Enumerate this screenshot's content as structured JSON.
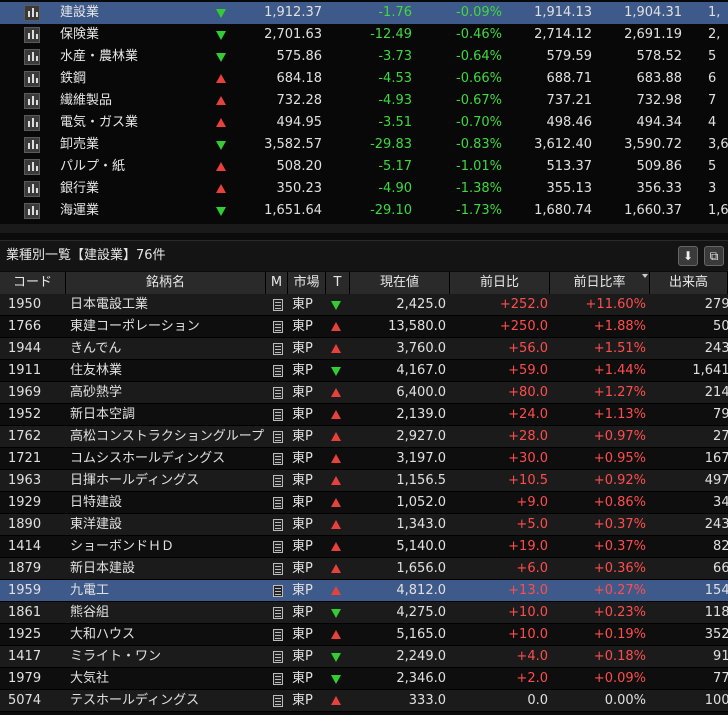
{
  "sectors": [
    {
      "name": "建設業",
      "dir": "down",
      "price": "1,912.37",
      "chg": "-1.76",
      "pct": "-0.09%",
      "open": "1,914.13",
      "low": "1,904.31",
      "extra": "1,",
      "selected": true
    },
    {
      "name": "保険業",
      "dir": "down",
      "price": "2,701.63",
      "chg": "-12.49",
      "pct": "-0.46%",
      "open": "2,714.12",
      "low": "2,691.19",
      "extra": "2,"
    },
    {
      "name": "水産・農林業",
      "dir": "down",
      "price": "575.86",
      "chg": "-3.73",
      "pct": "-0.64%",
      "open": "579.59",
      "low": "578.52",
      "extra": "5"
    },
    {
      "name": "鉄鋼",
      "dir": "up",
      "price": "684.18",
      "chg": "-4.53",
      "pct": "-0.66%",
      "open": "688.71",
      "low": "683.88",
      "extra": "6"
    },
    {
      "name": "繊維製品",
      "dir": "up",
      "price": "732.28",
      "chg": "-4.93",
      "pct": "-0.67%",
      "open": "737.21",
      "low": "732.98",
      "extra": "7"
    },
    {
      "name": "電気・ガス業",
      "dir": "up",
      "price": "494.95",
      "chg": "-3.51",
      "pct": "-0.70%",
      "open": "498.46",
      "low": "494.34",
      "extra": "4"
    },
    {
      "name": "卸売業",
      "dir": "down",
      "price": "3,582.57",
      "chg": "-29.83",
      "pct": "-0.83%",
      "open": "3,612.40",
      "low": "3,590.72",
      "extra": "3,6"
    },
    {
      "name": "パルプ・紙",
      "dir": "up",
      "price": "508.20",
      "chg": "-5.17",
      "pct": "-1.01%",
      "open": "513.37",
      "low": "509.86",
      "extra": "5"
    },
    {
      "name": "銀行業",
      "dir": "up",
      "price": "350.23",
      "chg": "-4.90",
      "pct": "-1.38%",
      "open": "355.13",
      "low": "356.33",
      "extra": "3"
    },
    {
      "name": "海運業",
      "dir": "down",
      "price": "1,651.64",
      "chg": "-29.10",
      "pct": "-1.73%",
      "open": "1,680.74",
      "low": "1,660.37",
      "extra": "1,6"
    }
  ],
  "list": {
    "title": "業種別一覧【建設業】76件",
    "download_icon": "⬇",
    "copy_icon": "⧉",
    "headers": {
      "code": "コード",
      "name": "銘柄名",
      "memo": "M",
      "market": "市場",
      "trend": "T",
      "price": "現在値",
      "chg": "前日比",
      "pct": "前日比率",
      "volume": "出来高"
    },
    "rows": [
      {
        "code": "1950",
        "name": "日本電設工業",
        "market": "東P",
        "dir": "down",
        "price": "2,425.0",
        "chg": "+252.0",
        "pct": "+11.60%",
        "vol": "279,6"
      },
      {
        "code": "1766",
        "name": "東建コーポレーション",
        "market": "東P",
        "dir": "up",
        "price": "13,580.0",
        "chg": "+250.0",
        "pct": "+1.88%",
        "vol": "50,8"
      },
      {
        "code": "1944",
        "name": "きんでん",
        "market": "東P",
        "dir": "up",
        "price": "3,760.0",
        "chg": "+56.0",
        "pct": "+1.51%",
        "vol": "243,8"
      },
      {
        "code": "1911",
        "name": "住友林業",
        "market": "東P",
        "dir": "down",
        "price": "4,167.0",
        "chg": "+59.0",
        "pct": "+1.44%",
        "vol": "1,641,4"
      },
      {
        "code": "1969",
        "name": "高砂熱学",
        "market": "東P",
        "dir": "up",
        "price": "6,400.0",
        "chg": "+80.0",
        "pct": "+1.27%",
        "vol": "214,1"
      },
      {
        "code": "1952",
        "name": "新日本空調",
        "market": "東P",
        "dir": "up",
        "price": "2,139.0",
        "chg": "+24.0",
        "pct": "+1.13%",
        "vol": "79,8"
      },
      {
        "code": "1762",
        "name": "高松コンストラクショングループ",
        "market": "東P",
        "dir": "up",
        "price": "2,927.0",
        "chg": "+28.0",
        "pct": "+0.97%",
        "vol": "27,2"
      },
      {
        "code": "1721",
        "name": "コムシスホールディングス",
        "market": "東P",
        "dir": "up",
        "price": "3,197.0",
        "chg": "+30.0",
        "pct": "+0.95%",
        "vol": "167,3"
      },
      {
        "code": "1963",
        "name": "日揮ホールディングス",
        "market": "東P",
        "dir": "up",
        "price": "1,156.5",
        "chg": "+10.5",
        "pct": "+0.92%",
        "vol": "497,9"
      },
      {
        "code": "1929",
        "name": "日特建設",
        "market": "東P",
        "dir": "up",
        "price": "1,052.0",
        "chg": "+9.0",
        "pct": "+0.86%",
        "vol": "34,3"
      },
      {
        "code": "1890",
        "name": "東洋建設",
        "market": "東P",
        "dir": "up",
        "price": "1,343.0",
        "chg": "+5.0",
        "pct": "+0.37%",
        "vol": "243,1"
      },
      {
        "code": "1414",
        "name": "ショーボンドＨＤ",
        "market": "東P",
        "dir": "up",
        "price": "5,140.0",
        "chg": "+19.0",
        "pct": "+0.37%",
        "vol": "82,5"
      },
      {
        "code": "1879",
        "name": "新日本建設",
        "market": "東P",
        "dir": "up",
        "price": "1,656.0",
        "chg": "+6.0",
        "pct": "+0.36%",
        "vol": "66,1"
      },
      {
        "code": "1959",
        "name": "九電工",
        "market": "東P",
        "dir": "up",
        "price": "4,812.0",
        "chg": "+13.0",
        "pct": "+0.27%",
        "vol": "154,3",
        "selected": true
      },
      {
        "code": "1861",
        "name": "熊谷組",
        "market": "東P",
        "dir": "down",
        "price": "4,275.0",
        "chg": "+10.0",
        "pct": "+0.23%",
        "vol": "118,4"
      },
      {
        "code": "1925",
        "name": "大和ハウス",
        "market": "東P",
        "dir": "up",
        "price": "5,165.0",
        "chg": "+10.0",
        "pct": "+0.19%",
        "vol": "352,0"
      },
      {
        "code": "1417",
        "name": "ミライト・ワン",
        "market": "東P",
        "dir": "down",
        "price": "2,249.0",
        "chg": "+4.0",
        "pct": "+0.18%",
        "vol": "91,3"
      },
      {
        "code": "1979",
        "name": "大気社",
        "market": "東P",
        "dir": "down",
        "price": "2,346.0",
        "chg": "+2.0",
        "pct": "+0.09%",
        "vol": "77,8"
      },
      {
        "code": "5074",
        "name": "テスホールディングス",
        "market": "東P",
        "dir": "up",
        "price": "333.0",
        "chg": "0.0",
        "pct": "0.00%",
        "vol": "100,5"
      }
    ]
  },
  "colors": {
    "up": "#e8403a",
    "down": "#33cc33",
    "positive": "#ff4d4d",
    "negative": "#3fd83f",
    "selected": "#3e5a8a"
  }
}
